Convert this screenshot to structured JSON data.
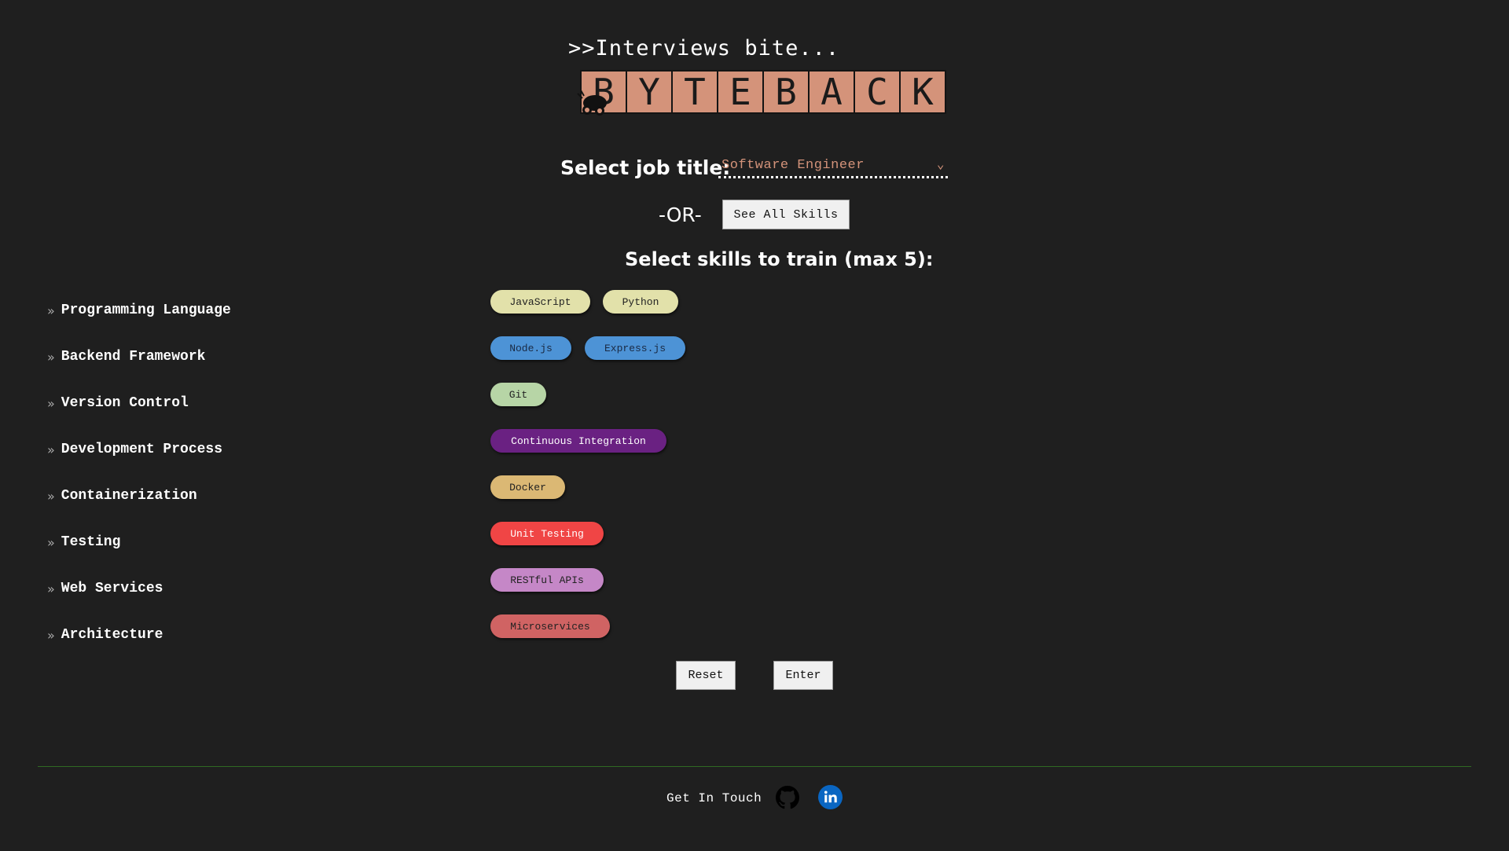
{
  "header": {
    "tagline": ">>Interviews bite...",
    "logo_letters": [
      "B",
      "Y",
      "T",
      "E",
      "B",
      "A",
      "C",
      "K"
    ]
  },
  "job_select": {
    "label": "Select job title:",
    "value": "Software Engineer",
    "chevron": "⌄"
  },
  "or_label": "-OR-",
  "see_all_label": "See All Skills",
  "skills_heading": "Select skills to train (max 5):",
  "categories": [
    {
      "name": "Programming Language",
      "skills": [
        {
          "label": "JavaScript",
          "bg": "#e2e1aa",
          "fg": "#222222"
        },
        {
          "label": "Python",
          "bg": "#e2e1aa",
          "fg": "#222222"
        }
      ]
    },
    {
      "name": "Backend Framework",
      "skills": [
        {
          "label": "Node.js",
          "bg": "#4d93d6",
          "fg": "#1a2a44"
        },
        {
          "label": "Express.js",
          "bg": "#4d93d6",
          "fg": "#1a2a44"
        }
      ]
    },
    {
      "name": "Version Control",
      "skills": [
        {
          "label": "Git",
          "bg": "#b7d5a6",
          "fg": "#222222"
        }
      ]
    },
    {
      "name": "Development Process",
      "skills": [
        {
          "label": "Continuous Integration",
          "bg": "#6a2182",
          "fg": "#ffffff"
        }
      ]
    },
    {
      "name": "Containerization",
      "skills": [
        {
          "label": "Docker",
          "bg": "#dbb874",
          "fg": "#222222"
        }
      ]
    },
    {
      "name": "Testing",
      "skills": [
        {
          "label": "Unit Testing",
          "bg": "#f04545",
          "fg": "#ffffff"
        }
      ]
    },
    {
      "name": "Web Services",
      "skills": [
        {
          "label": "RESTful APIs",
          "bg": "#c587c7",
          "fg": "#222222"
        }
      ]
    },
    {
      "name": "Architecture",
      "skills": [
        {
          "label": "Microservices",
          "bg": "#d06363",
          "fg": "#222222"
        }
      ]
    }
  ],
  "category_arrow": "»",
  "buttons": {
    "reset": "Reset",
    "enter": "Enter"
  },
  "footer": {
    "text": "Get In Touch"
  },
  "colors": {
    "accent": "#d4937a",
    "divider": "#2f6a23",
    "background": "#1f1f1f",
    "linkedin": "#0a66c2"
  }
}
